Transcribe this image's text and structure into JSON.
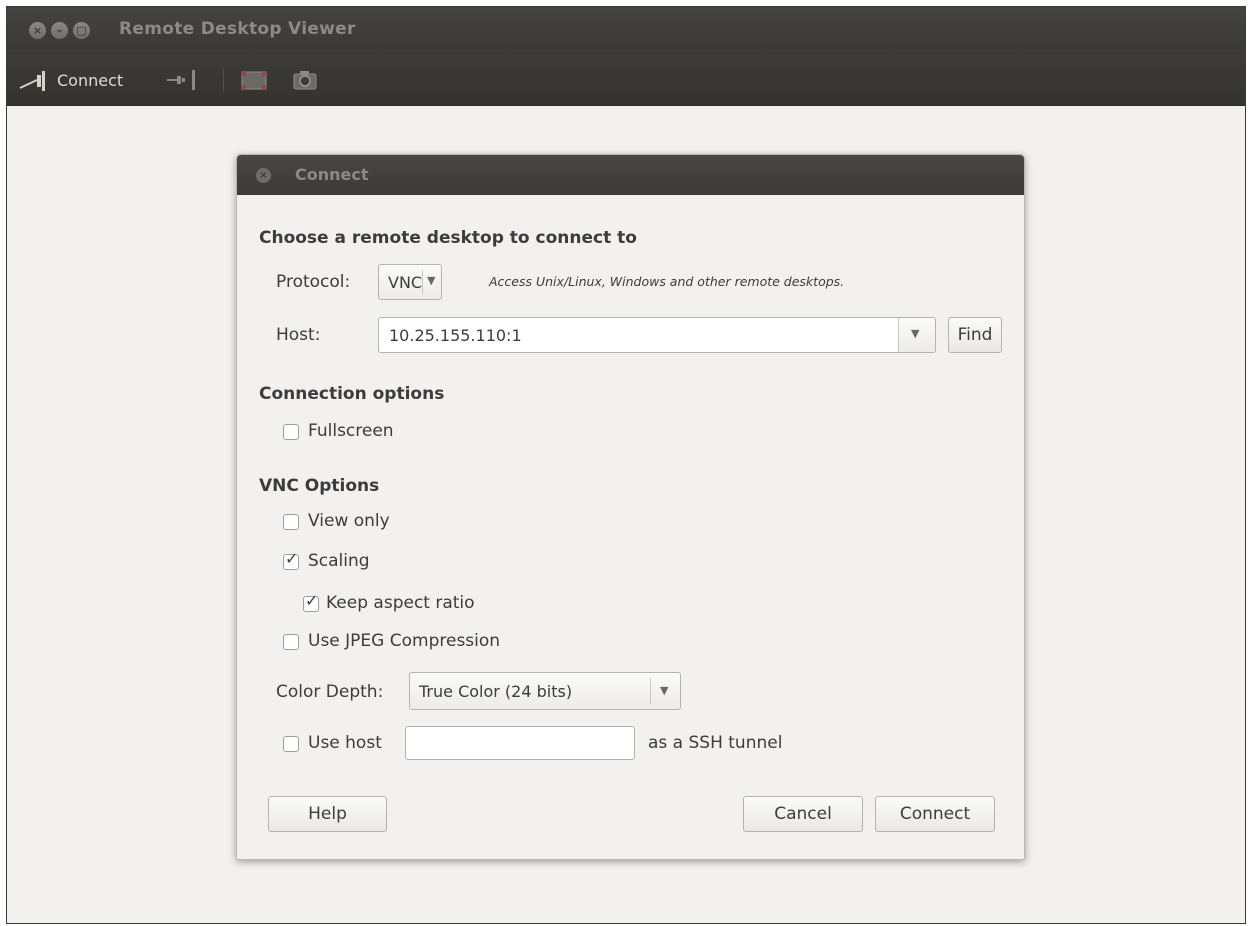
{
  "window": {
    "title": "Remote Desktop Viewer",
    "buttons": [
      "close",
      "minimize",
      "maximize"
    ]
  },
  "toolbar": {
    "connect_label": "Connect",
    "icons": [
      "connect-plug-icon",
      "disconnect-plug-icon",
      "fullscreen-icon",
      "screenshot-icon"
    ]
  },
  "dialog": {
    "title": "Connect",
    "heading": "Choose a remote desktop to connect to",
    "protocol_label": "Protocol:",
    "protocol_value": "VNC",
    "protocol_hint": "Access Unix/Linux, Windows and other remote desktops.",
    "host_label": "Host:",
    "host_value": "10.25.155.110:1",
    "find_label": "Find",
    "connection_options_heading": "Connection options",
    "fullscreen_label": "Fullscreen",
    "fullscreen_checked": false,
    "vnc_options_heading": "VNC Options",
    "view_only_label": "View only",
    "view_only_checked": false,
    "scaling_label": "Scaling",
    "scaling_checked": true,
    "keep_aspect_label": "Keep aspect ratio",
    "keep_aspect_checked": true,
    "jpeg_label": "Use JPEG Compression",
    "jpeg_checked": false,
    "color_depth_label": "Color Depth:",
    "color_depth_value": "True Color (24 bits)",
    "use_host_label": "Use host",
    "use_host_checked": false,
    "ssh_host_value": "",
    "ssh_suffix": "as a SSH tunnel",
    "help_label": "Help",
    "cancel_label": "Cancel",
    "connect_label": "Connect"
  },
  "colors": {
    "titlebar": "#3c3b37",
    "window_bg": "#f2f1f0",
    "text": "#3c3c3c",
    "inactive_title": "#8c8a86"
  }
}
